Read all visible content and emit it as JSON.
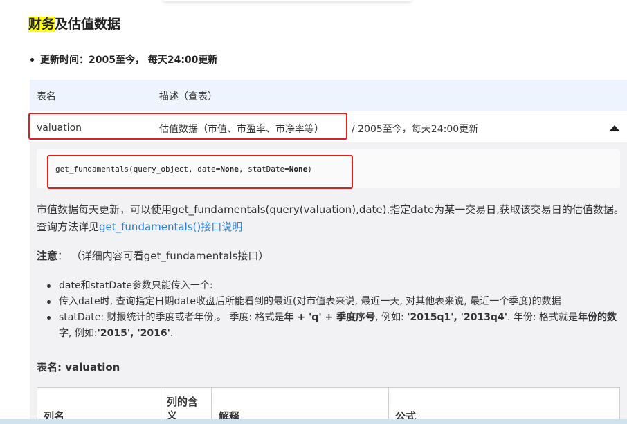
{
  "heading": {
    "highlight": "财务",
    "rest": "及估值数据"
  },
  "update_time": "更新时间：2005至今， 每天24:00更新",
  "table_header": {
    "col1": "表名",
    "col2": "描述（查表）"
  },
  "row": {
    "name": "valuation",
    "desc": "估值数据（市值、市盈率、市净率等）",
    "extra": "/ 2005至今，每天24:00更新"
  },
  "code": {
    "prefix": "get_fundamentals(query_object, date=",
    "none1": "None",
    "mid": ", statDate=",
    "none2": "None",
    "suffix": ")"
  },
  "paragraph": {
    "text": "市值数据每天更新，可以使用get_fundamentals(query(valuation),date),指定date为某一交易日,获取该交易日的估值数据。查询方法详见",
    "link": "get_fundamentals()接口说明"
  },
  "note": {
    "label": "注意",
    "text": "：  （详细内容可看get_fundamentals接口）"
  },
  "bullets": {
    "b1": "date和statDate参数只能传入一个:",
    "b2": "传入date时, 查询指定日期date收盘后所能看到的最近(对市值表来说, 最近一天, 对其他表来说, 最近一个季度)的数据",
    "b3_a": "statDate: 财报统计的季度或者年份,。 季度: 格式是",
    "b3_b": "年 + 'q' + 季度序号",
    "b3_c": ", 例如: ",
    "b3_d": "'2015q1', '2013q4'",
    "b3_e": ". 年份: 格式就是",
    "b3_f": "年份的数字",
    "b3_g": ", 例如:",
    "b3_h": "'2015', '2016'",
    "b3_i": "."
  },
  "table_name": "表名: valuation",
  "columns": [
    "列名",
    "列的含义",
    "解释",
    "公式"
  ]
}
